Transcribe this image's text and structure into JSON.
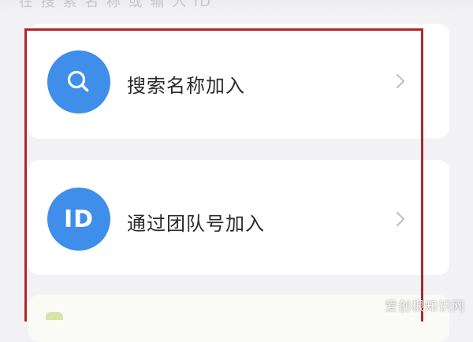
{
  "header": {
    "partial_text": "在 搜 索 名 称 或 输 入 ID"
  },
  "options": [
    {
      "label": "搜索名称加入",
      "icon": "search-icon"
    },
    {
      "label": "通过团队号加入",
      "icon": "id-icon",
      "icon_text": "ID"
    }
  ],
  "third_option": {
    "icon": "partial-icon"
  },
  "watermark": {
    "text": "爱创根知识网"
  },
  "colors": {
    "accent": "#3e8eea",
    "highlight_frame": "#b3252b",
    "background": "#f2f2f4",
    "card": "#ffffff",
    "chevron": "#bcbcc2"
  }
}
